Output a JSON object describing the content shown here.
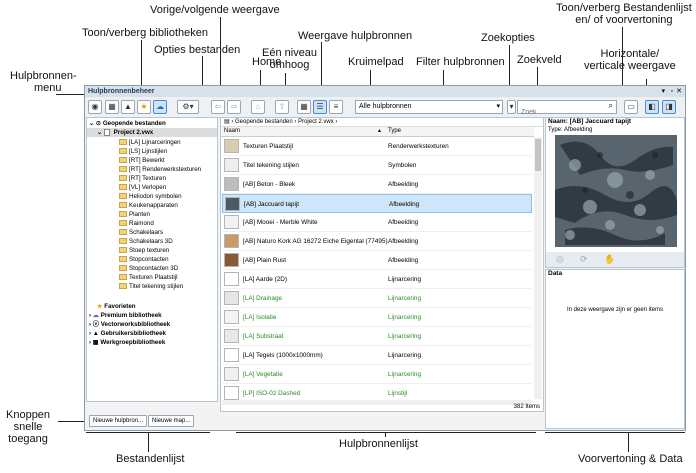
{
  "window": {
    "title": "Hulpbronnenbeheer",
    "title_icons": [
      "pin-icon",
      "minimize-icon",
      "close-icon"
    ]
  },
  "callouts": {
    "vorige_volgende": "Vorige/volgende weergave",
    "weergave_hulpbronnen": "Weergave hulpbronnen",
    "toon_verberg_voorvertoning_1": "Toon/verberg Bestandenlijst",
    "toon_verberg_voorvertoning_2": "en/ of voorvertoning",
    "toon_verberg_bibliotheken": "Toon/verberg bibliotheken",
    "een_niveau_1": "Eén niveau",
    "een_niveau_2": "omhoog",
    "zoekopties": "Zoekopties",
    "horizontale_1": "Horizontale/",
    "horizontale_2": "verticale weergave",
    "opties_bestanden": "Opties bestanden",
    "home": "Home",
    "kruimelpad": "Kruimelpad",
    "filter": "Filter hulpbronnen",
    "zoekveld": "Zoekveld",
    "menu_1": "Hulpbronnen-",
    "menu_2": "menu",
    "knoppen_1": "Knoppen",
    "knoppen_2": "snelle",
    "knoppen_3": "toegang",
    "bestandenlijst": "Bestandenlijst",
    "hulpbronnenlijst": "Hulpbronnenlijst",
    "voorvertoning_data": "Voorvertoning & Data"
  },
  "toolbar": {
    "filter_value": "Alle hulpbronnen",
    "search_placeholder": "Zoek",
    "breadcrumb": [
      "Geopende bestanden",
      "Project 2.vwx"
    ]
  },
  "tree": {
    "open_files": "Geopende bestanden",
    "project": "Project 2.vwx",
    "folders": [
      "[LA] Lijnarceringen",
      "[LS] Lijnstijlen",
      "[RT] Bewerkt",
      "[RT] Renderwerkstexturen",
      "[RT] Texturen",
      "[VL] Verlopen",
      "Heliodon symbolen",
      "Keukenapparaten",
      "Planten",
      "Raimond",
      "Schakelaars",
      "Schakelaars 3D",
      "Stoep texturen",
      "Stopcontacten",
      "Stopcontacten 3D",
      "Texturen Plaatstijl",
      "Titel tekening stijlen"
    ],
    "libraries": [
      "Favorieten",
      "Premium bibliotheek",
      "Vectorworksbibliotheek",
      "Gebruikersbibliotheek",
      "Werkgroepbibliotheek"
    ]
  },
  "list": {
    "col_name": "Naam",
    "col_type": "Type",
    "rows": [
      {
        "name": "Texturen Plaatstijl",
        "type": "Renderwerkstexturen",
        "thumb": "#d9cdb0",
        "green": false
      },
      {
        "name": "Titel tekening stijlen",
        "type": "Symbolen",
        "thumb": "#eeeeee",
        "green": false
      },
      {
        "name": "[AB] Beton - Bleek",
        "type": "Afbeelding",
        "thumb": "#bdbdbd",
        "green": false
      },
      {
        "name": "[AB] Jaccuard tapijt",
        "type": "Afbeelding",
        "thumb": "#4b5a66",
        "green": false
      },
      {
        "name": "[AB] Mooei - Merble White",
        "type": "Afbeelding",
        "thumb": "#f2f2f2",
        "green": false
      },
      {
        "name": "[AB] Naturo Kork AG 16272 Eiche Eigental (77495)",
        "type": "Afbeelding",
        "thumb": "#c79a66",
        "green": false
      },
      {
        "name": "[AB] Plain Rust",
        "type": "Afbeelding",
        "thumb": "#8a5a32",
        "green": false
      },
      {
        "name": "[LA] Aarde (2D)",
        "type": "Lijnarcering",
        "thumb": "#ffffff",
        "green": false
      },
      {
        "name": "[LA] Drainage",
        "type": "Lijnarcering",
        "thumb": "#e6e6e6",
        "green": true
      },
      {
        "name": "[LA] Isolatie",
        "type": "Lijnarcering",
        "thumb": "#f4f4f4",
        "green": true
      },
      {
        "name": "[LA] Substraat",
        "type": "Lijnarcering",
        "thumb": "#e8e8e8",
        "green": true
      },
      {
        "name": "[LA] Tegels (1000x1000mm)",
        "type": "Lijnarcering",
        "thumb": "#ffffff",
        "green": false
      },
      {
        "name": "[LA] Vegetatie",
        "type": "Lijnarcering",
        "thumb": "#f0f0f0",
        "green": true
      },
      {
        "name": "[LP] ISO-02 Dashed",
        "type": "Lijnstijl",
        "thumb": "#ffffff",
        "green": true
      }
    ],
    "count": "382 Items"
  },
  "preview": {
    "name_label": "Naam: [AB] Jaccuard tapijt",
    "type_label": "Type: Afbeelding",
    "data_header": "Data",
    "data_message": "In deze weergave zijn er geen items"
  },
  "quick_buttons": [
    "Nieuwe hulpbron...",
    "Nieuwe map..."
  ],
  "colors": {
    "accent": "#4a8bd0",
    "selection": "#cfe5fa",
    "green_text": "#2a8a2a"
  }
}
